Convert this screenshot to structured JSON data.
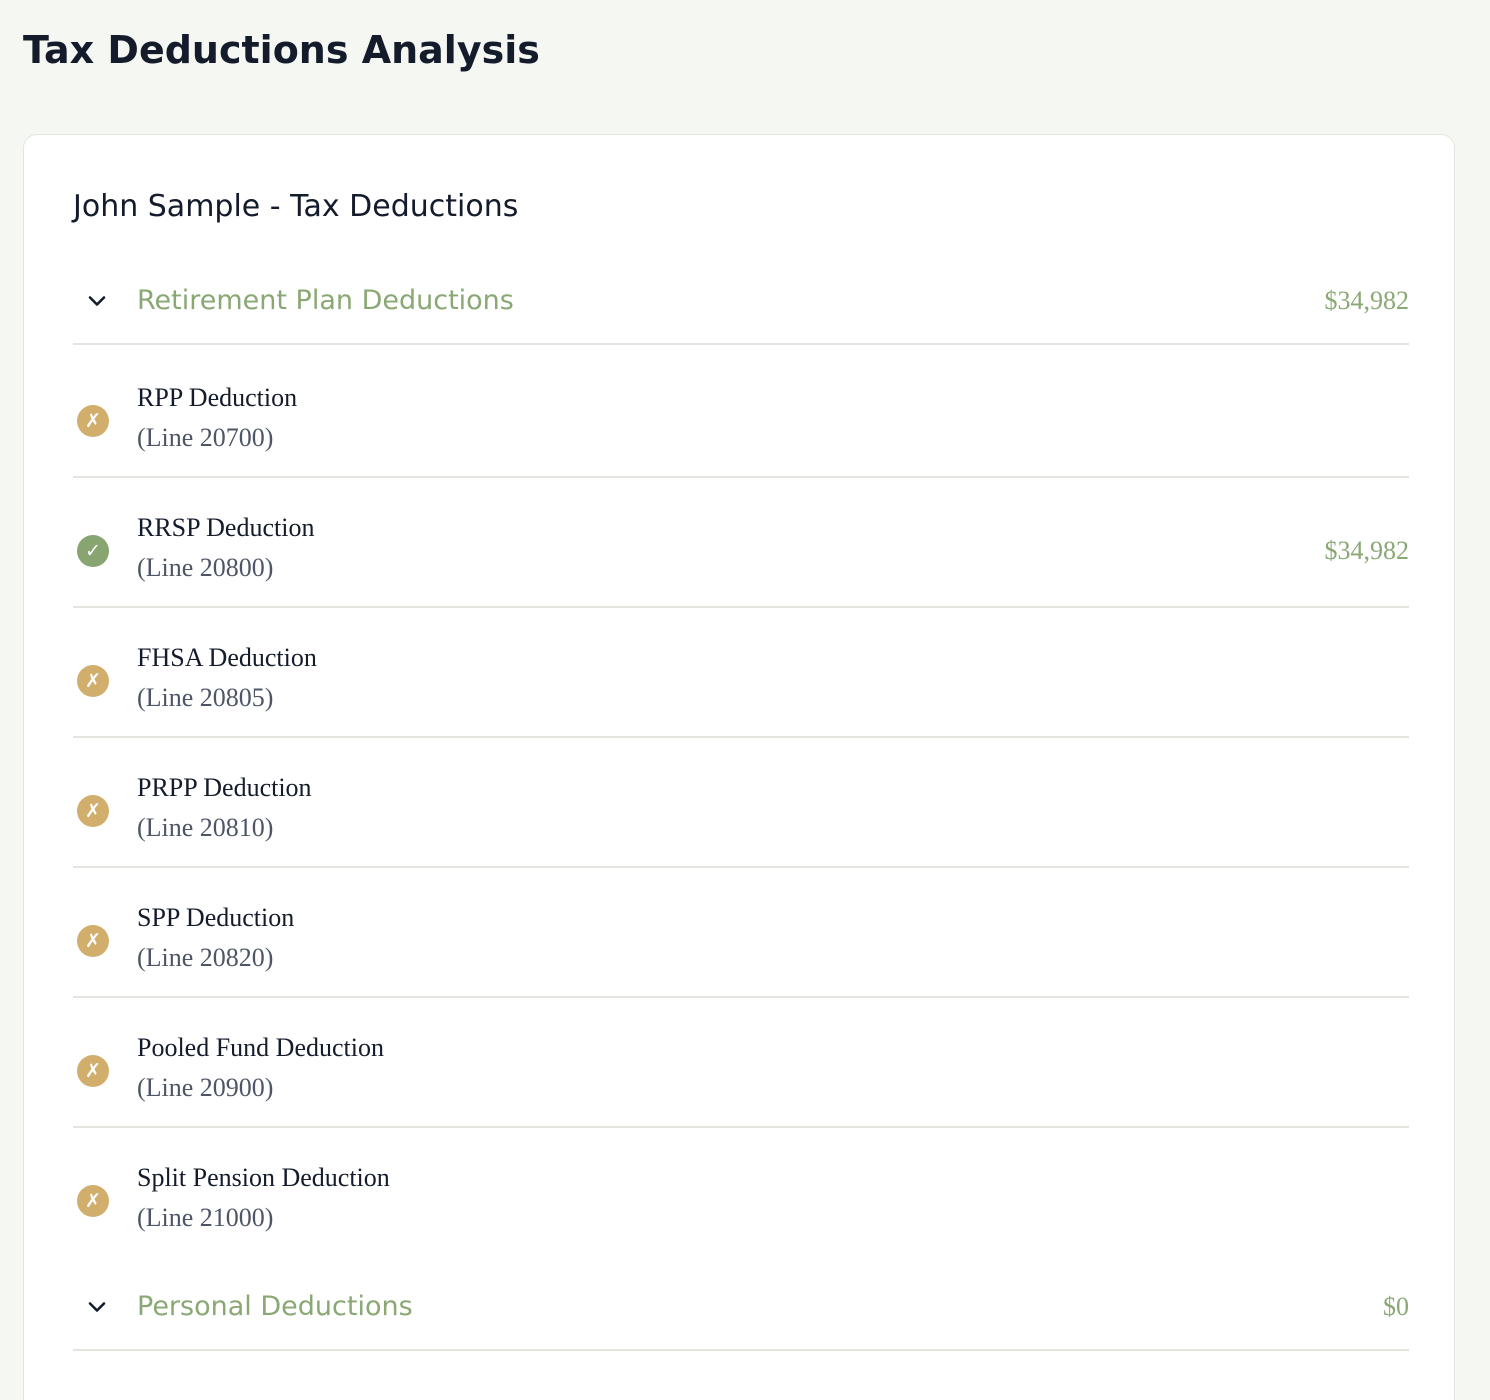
{
  "page": {
    "title": "Tax Deductions Analysis"
  },
  "card": {
    "title": "John Sample - Tax Deductions"
  },
  "colors": {
    "background": "#f5f7f2",
    "accent_green": "#8aa874",
    "status_yes": "#87a471",
    "status_no": "#d2ae6d",
    "text_dark": "#141b2b",
    "text_muted": "#4d5566"
  },
  "sections": [
    {
      "label": "Retirement Plan Deductions",
      "amount": "$34,982",
      "expanded": true,
      "icon": "chevron-down-icon",
      "items": [
        {
          "name": "RPP Deduction",
          "line": "(Line 20700)",
          "status": "not-claimed",
          "status_glyph": "✗",
          "amount": ""
        },
        {
          "name": "RRSP Deduction",
          "line": "(Line 20800)",
          "status": "claimed",
          "status_glyph": "✓",
          "amount": "$34,982"
        },
        {
          "name": "FHSA Deduction",
          "line": "(Line 20805)",
          "status": "not-claimed",
          "status_glyph": "✗",
          "amount": ""
        },
        {
          "name": "PRPP Deduction",
          "line": "(Line 20810)",
          "status": "not-claimed",
          "status_glyph": "✗",
          "amount": ""
        },
        {
          "name": "SPP Deduction",
          "line": "(Line 20820)",
          "status": "not-claimed",
          "status_glyph": "✗",
          "amount": ""
        },
        {
          "name": "Pooled Fund Deduction",
          "line": "(Line 20900)",
          "status": "not-claimed",
          "status_glyph": "✗",
          "amount": ""
        },
        {
          "name": "Split Pension Deduction",
          "line": "(Line 21000)",
          "status": "not-claimed",
          "status_glyph": "✗",
          "amount": ""
        }
      ]
    },
    {
      "label": "Personal Deductions",
      "amount": "$0",
      "expanded": true,
      "icon": "chevron-down-icon",
      "items": []
    }
  ]
}
